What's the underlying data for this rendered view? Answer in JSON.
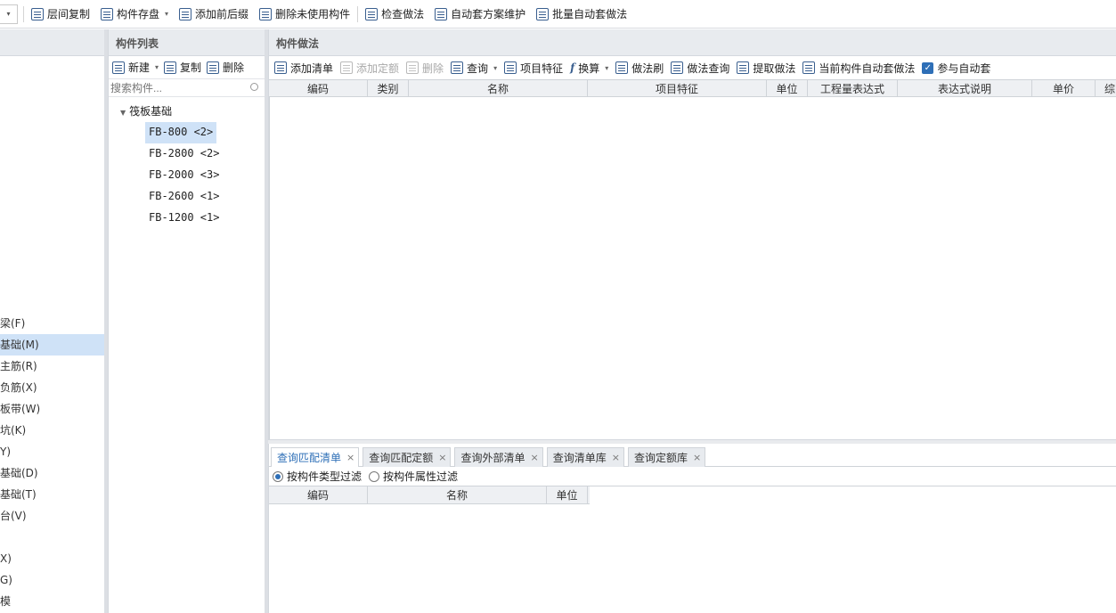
{
  "top_toolbar": {
    "items": [
      "层间复制",
      "构件存盘",
      "添加前后缀",
      "删除未使用构件",
      "检查做法",
      "自动套方案维护",
      "批量自动套做法"
    ]
  },
  "left_panel": {
    "items": [
      {
        "label": "梁(F)",
        "selected": false
      },
      {
        "label": "基础(M)",
        "selected": true
      },
      {
        "label": "主筋(R)",
        "selected": false
      },
      {
        "label": "负筋(X)",
        "selected": false
      },
      {
        "label": "板带(W)",
        "selected": false
      },
      {
        "label": "坑(K)",
        "selected": false
      },
      {
        "label": "Y)",
        "selected": false
      },
      {
        "label": "基础(D)",
        "selected": false
      },
      {
        "label": "基础(T)",
        "selected": false
      },
      {
        "label": "台(V)",
        "selected": false
      },
      {
        "label": "",
        "selected": false
      },
      {
        "label": "X)",
        "selected": false
      },
      {
        "label": "G)",
        "selected": false
      },
      {
        "label": "模",
        "selected": false
      }
    ]
  },
  "component_list": {
    "title": "构件列表",
    "toolbar": {
      "new": "新建",
      "copy": "复制",
      "delete": "删除"
    },
    "search_placeholder": "搜索构件...",
    "group": "筏板基础",
    "items": [
      "FB-800 <2>",
      "FB-2800 <2>",
      "FB-2000 <3>",
      "FB-2600 <1>",
      "FB-1200 <1>"
    ],
    "selected_index": 0
  },
  "method_panel": {
    "title": "构件做法",
    "toolbar": {
      "add_list": "添加清单",
      "add_quota": "添加定额",
      "delete": "删除",
      "query": "查询",
      "item_feature": "项目特征",
      "convert": "换算",
      "method_brush": "做法刷",
      "method_query": "做法查询",
      "extract_method": "提取做法",
      "auto_method": "当前构件自动套做法",
      "participate_auto": "参与自动套",
      "participate_checked": true
    },
    "columns": [
      "编码",
      "类别",
      "名称",
      "项目特征",
      "单位",
      "工程量表达式",
      "表达式说明",
      "单价",
      "综"
    ]
  },
  "bottom_panel": {
    "tabs": [
      {
        "label": "查询匹配清单",
        "active": true
      },
      {
        "label": "查询匹配定额",
        "active": false
      },
      {
        "label": "查询外部清单",
        "active": false
      },
      {
        "label": "查询清单库",
        "active": false
      },
      {
        "label": "查询定额库",
        "active": false
      }
    ],
    "filter_type": "按构件类型过滤",
    "filter_attr": "按构件属性过滤",
    "columns": [
      "编码",
      "名称",
      "单位"
    ]
  }
}
